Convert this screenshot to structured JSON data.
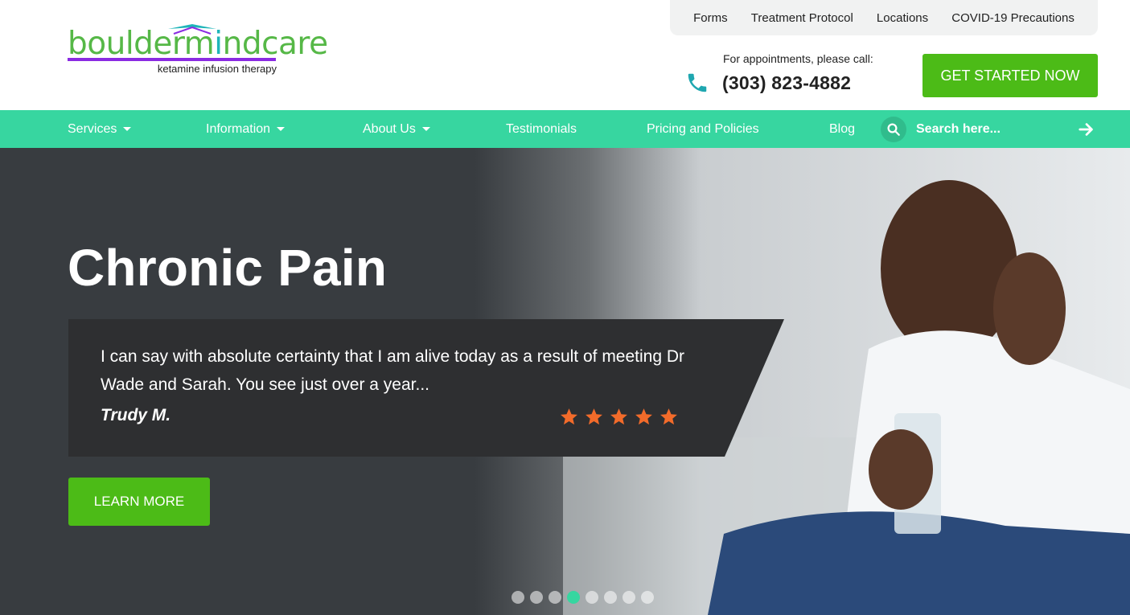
{
  "logo": {
    "word_part1": "boulderm",
    "word_part2": "i",
    "word_part3": "ndcare",
    "tagline": "ketamine infusion therapy"
  },
  "topbar": {
    "links": [
      "Forms",
      "Treatment Protocol",
      "Locations",
      "COVID-19 Precautions"
    ]
  },
  "contact": {
    "label": "For appointments, please call:",
    "phone": "(303) 823-4882"
  },
  "cta": {
    "label": "GET STARTED NOW"
  },
  "nav": {
    "items": [
      {
        "label": "Services"
      },
      {
        "label": "Information"
      },
      {
        "label": "About Us"
      },
      {
        "label": "Testimonials"
      },
      {
        "label": "Pricing and Policies"
      },
      {
        "label": "Blog"
      }
    ],
    "search_placeholder": "Search here..."
  },
  "hero": {
    "title": "Chronic Pain",
    "quote": "I can say with absolute certainty that I am alive today as a result of meeting Dr Wade and Sarah. You see just over a year...",
    "author": "Trudy M.",
    "rating": 5,
    "button_label": "LEARN MORE",
    "slides_total": 8,
    "slide_active": 4
  },
  "colors": {
    "nav_green": "#37d6a0",
    "button_green": "#4cbb17",
    "star_orange": "#f26b2a",
    "logo_purple": "#8a2be2",
    "logo_teal": "#1fb5b9"
  }
}
